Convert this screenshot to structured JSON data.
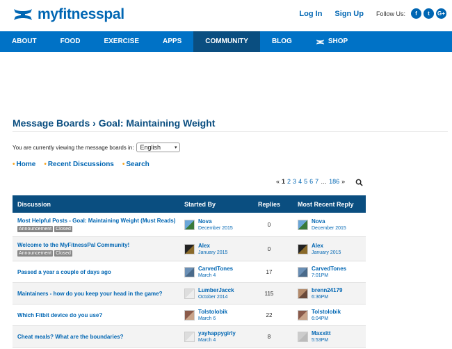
{
  "header": {
    "logo_text": "myfitnesspal",
    "login_label": "Log In",
    "signup_label": "Sign Up",
    "follow_label": "Follow Us:",
    "social": [
      {
        "label": "f",
        "icon": "facebook-icon"
      },
      {
        "label": "t",
        "icon": "twitter-icon"
      },
      {
        "label": "G+",
        "icon": "googleplus-icon"
      }
    ]
  },
  "nav": {
    "items": [
      {
        "label": "ABOUT"
      },
      {
        "label": "FOOD"
      },
      {
        "label": "EXERCISE"
      },
      {
        "label": "APPS"
      },
      {
        "label": "COMMUNITY",
        "active": true
      },
      {
        "label": "BLOG"
      },
      {
        "label": "SHOP",
        "icon": "under-armour-icon"
      }
    ]
  },
  "page": {
    "title": "Message Boards › Goal: Maintaining Weight",
    "lang_prompt": "You are currently viewing the message boards in:",
    "lang_value": "English",
    "links": [
      "Home",
      "Recent Discussions",
      "Search"
    ],
    "pager": {
      "prev": "«",
      "current": "1",
      "pages": [
        "2",
        "3",
        "4",
        "5",
        "6",
        "7"
      ],
      "ellipsis": "…",
      "last": "186",
      "next": "»"
    }
  },
  "table": {
    "headers": {
      "discussion": "Discussion",
      "started_by": "Started By",
      "replies": "Replies",
      "recent": "Most Recent Reply"
    },
    "rows": [
      {
        "title": "Most Helpful Posts - Goal: Maintaining Weight (Must Reads)",
        "tags": [
          "Announcement",
          "Closed"
        ],
        "starter": "Nova",
        "start_date": "December 2015",
        "replies": "0",
        "recent_user": "Nova",
        "recent_date": "December 2015"
      },
      {
        "title": "Welcome to the MyFitnessPal Community!",
        "tags": [
          "Announcement",
          "Closed"
        ],
        "starter": "Alex",
        "start_date": "January 2015",
        "replies": "0",
        "recent_user": "Alex",
        "recent_date": "January 2015"
      },
      {
        "title": "Passed a year a couple of days ago",
        "tags": [],
        "starter": "CarvedTones",
        "start_date": "March 4",
        "replies": "17",
        "recent_user": "CarvedTones",
        "recent_date": "7:01PM"
      },
      {
        "title": "Maintainers - how do you keep your head in the game?",
        "tags": [],
        "starter": "LumberJacck",
        "start_date": "October 2014",
        "replies": "115",
        "recent_user": "brenn24179",
        "recent_date": "6:36PM"
      },
      {
        "title": "Which Fitbit device do you use?",
        "tags": [],
        "starter": "Tolstolobik",
        "start_date": "March 6",
        "replies": "22",
        "recent_user": "Tolstolobik",
        "recent_date": "6:04PM"
      },
      {
        "title": "Cheat meals? What are the boundaries?",
        "tags": [],
        "starter": "yayhappygirly",
        "start_date": "March 4",
        "replies": "8",
        "recent_user": "Maxxitt",
        "recent_date": "5:53PM"
      }
    ]
  },
  "colors": {
    "brand": "#0066b3",
    "nav_bg": "#0072c6",
    "nav_active": "#0a4e80",
    "table_header": "#0a4e80",
    "bullet": "#f7a521"
  }
}
